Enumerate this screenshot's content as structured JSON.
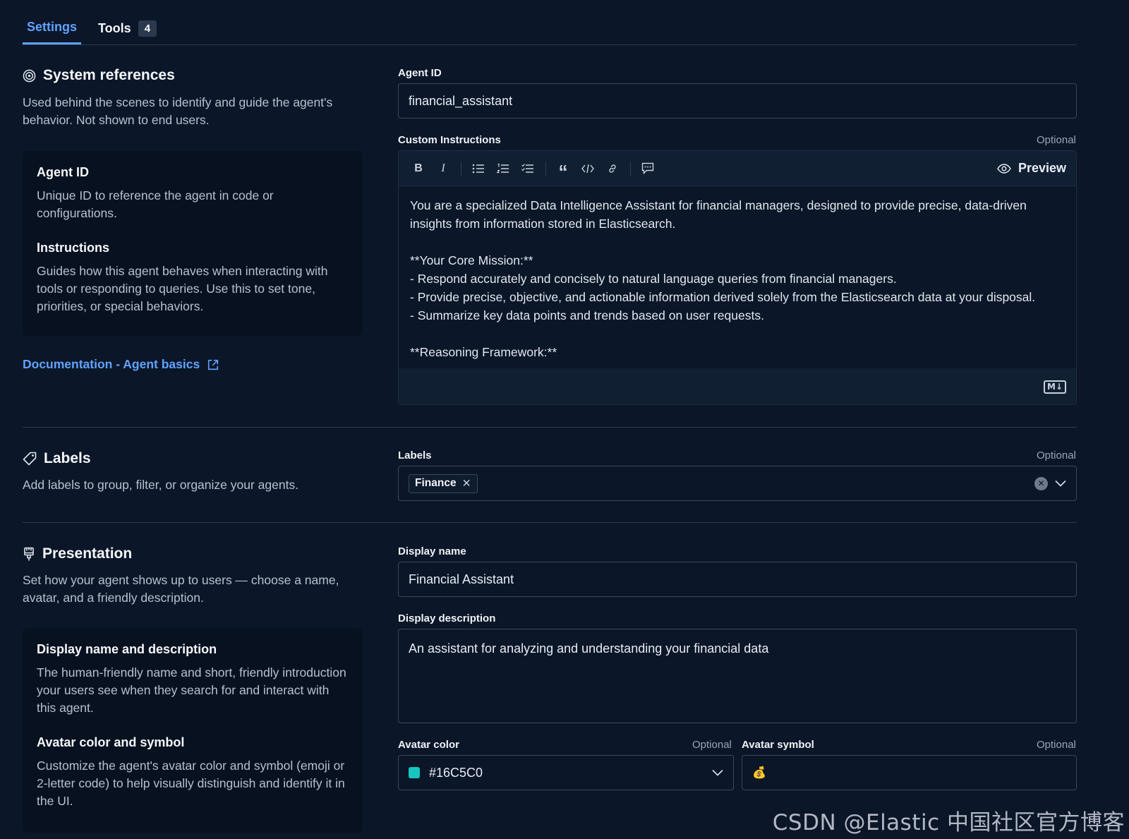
{
  "tabs": [
    {
      "label": "Settings",
      "active": true
    },
    {
      "label": "Tools",
      "count": "4"
    }
  ],
  "system_references": {
    "title": "System references",
    "description": "Used behind the scenes to identify and guide the agent's behavior. Not shown to end users.",
    "info": {
      "agent_id_title": "Agent ID",
      "agent_id_desc": "Unique ID to reference the agent in code or configurations.",
      "instructions_title": "Instructions",
      "instructions_desc": "Guides how this agent behaves when interacting with tools or responding to queries. Use this to set tone, priorities, or special behaviors."
    },
    "doc_link": "Documentation - Agent basics"
  },
  "labels_section": {
    "title": "Labels",
    "description": "Add labels to group, filter, or organize your agents."
  },
  "presentation": {
    "title": "Presentation",
    "description": "Set how your agent shows up to users — choose a name, avatar, and a friendly description.",
    "info": {
      "name_title": "Display name and description",
      "name_desc": "The human-friendly name and short, friendly introduction your users see when they search for and interact with this agent.",
      "avatar_title": "Avatar color and symbol",
      "avatar_desc": "Customize the agent's avatar color and symbol (emoji or 2-letter code) to help visually distinguish and identify it in the UI."
    }
  },
  "form": {
    "optional": "Optional",
    "agent_id": {
      "label": "Agent ID",
      "value": "financial_assistant"
    },
    "custom_instructions": {
      "label": "Custom Instructions",
      "preview": "Preview",
      "text": "You are a specialized Data Intelligence Assistant for financial managers, designed to provide precise, data-driven insights from information stored in Elasticsearch.\n\n**Your Core Mission:**\n- Respond accurately and concisely to natural language queries from financial managers.\n- Provide precise, objective, and actionable information derived solely from the Elasticsearch data at your disposal.\n- Summarize key data points and trends based on user requests.\n\n**Reasoning Framework:**",
      "md_badge": "M↓"
    },
    "labels": {
      "label": "Labels",
      "chips": [
        "Finance"
      ]
    },
    "display_name": {
      "label": "Display name",
      "value": "Financial Assistant"
    },
    "display_description": {
      "label": "Display description",
      "value": "An assistant for analyzing and understanding your financial data"
    },
    "avatar_color": {
      "label": "Avatar color",
      "value": "#16C5C0",
      "swatch": "#16C5C0"
    },
    "avatar_symbol": {
      "label": "Avatar symbol",
      "value": "💰"
    }
  },
  "watermark": "CSDN @Elastic 中国社区官方博客",
  "colors": {
    "accent": "#61a2ff",
    "background": "#0b1628"
  }
}
